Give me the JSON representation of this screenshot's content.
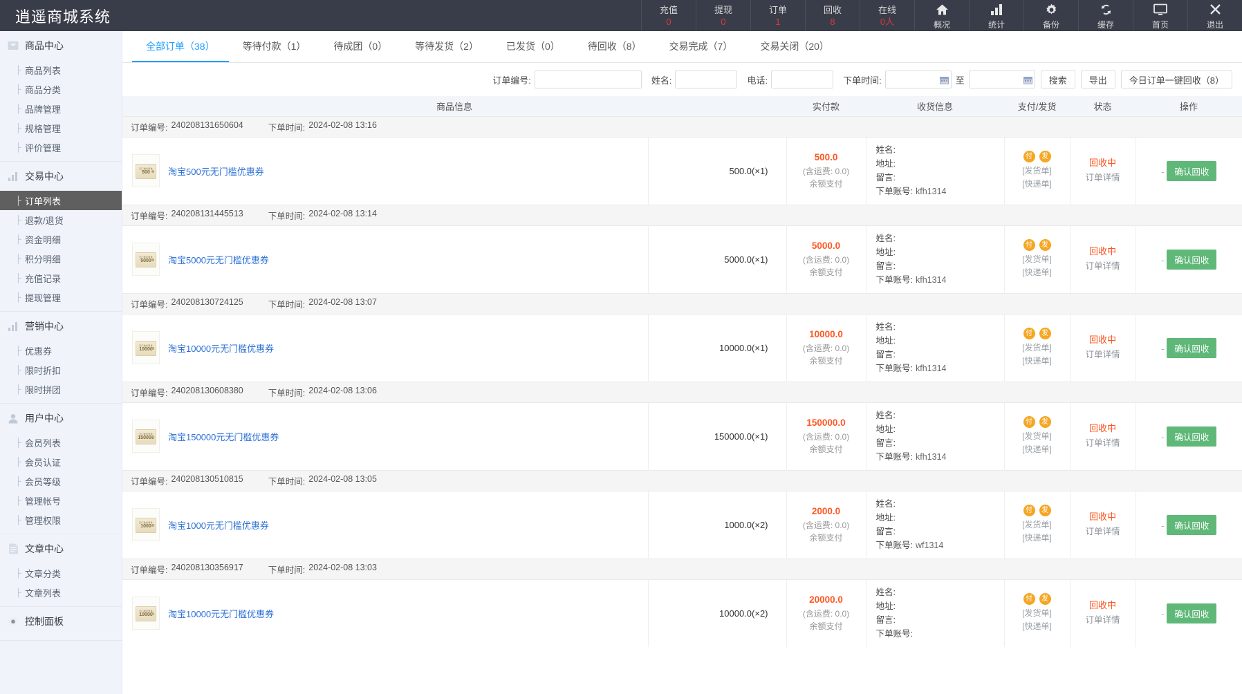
{
  "app": {
    "title": "逍遥商城系统"
  },
  "topbar": {
    "stats": [
      {
        "label": "充值",
        "value": "0"
      },
      {
        "label": "提现",
        "value": "0"
      },
      {
        "label": "订单",
        "value": "1"
      },
      {
        "label": "回收",
        "value": "8"
      },
      {
        "label": "在线",
        "value": "0人"
      }
    ],
    "nav": [
      {
        "label": "概况",
        "icon": "home-icon"
      },
      {
        "label": "统计",
        "icon": "bar-chart-icon"
      },
      {
        "label": "备份",
        "icon": "gear-icon"
      },
      {
        "label": "缓存",
        "icon": "refresh-icon"
      },
      {
        "label": "首页",
        "icon": "monitor-icon"
      },
      {
        "label": "退出",
        "icon": "close-icon"
      }
    ]
  },
  "sidebar": {
    "groups": [
      {
        "title": "商品中心",
        "icon": "box-icon",
        "items": [
          {
            "label": "商品列表",
            "active": false
          },
          {
            "label": "商品分类",
            "active": false
          },
          {
            "label": "品牌管理",
            "active": false
          },
          {
            "label": "规格管理",
            "active": false
          },
          {
            "label": "评价管理",
            "active": false
          }
        ]
      },
      {
        "title": "交易中心",
        "icon": "chart-icon",
        "items": [
          {
            "label": "订单列表",
            "active": true
          },
          {
            "label": "退款/退货",
            "active": false
          },
          {
            "label": "资金明细",
            "active": false
          },
          {
            "label": "积分明细",
            "active": false
          },
          {
            "label": "充值记录",
            "active": false
          },
          {
            "label": "提现管理",
            "active": false
          }
        ]
      },
      {
        "title": "营销中心",
        "icon": "chart-icon",
        "items": [
          {
            "label": "优惠券",
            "active": false
          },
          {
            "label": "限时折扣",
            "active": false
          },
          {
            "label": "限时拼团",
            "active": false
          }
        ]
      },
      {
        "title": "用户中心",
        "icon": "user-icon",
        "items": [
          {
            "label": "会员列表",
            "active": false
          },
          {
            "label": "会员认证",
            "active": false
          },
          {
            "label": "会员等级",
            "active": false
          },
          {
            "label": "管理帐号",
            "active": false
          },
          {
            "label": "管理权限",
            "active": false
          }
        ]
      },
      {
        "title": "文章中心",
        "icon": "doc-icon",
        "items": [
          {
            "label": "文章分类",
            "active": false
          },
          {
            "label": "文章列表",
            "active": false
          }
        ]
      },
      {
        "title": "控制面板",
        "icon": "gear-icon",
        "items": []
      }
    ]
  },
  "tabs": [
    {
      "label": "全部订单（38）",
      "active": true
    },
    {
      "label": "等待付款（1）",
      "active": false
    },
    {
      "label": "待成团（0）",
      "active": false
    },
    {
      "label": "等待发货（2）",
      "active": false
    },
    {
      "label": "已发货（0）",
      "active": false
    },
    {
      "label": "待回收（8）",
      "active": false
    },
    {
      "label": "交易完成（7）",
      "active": false
    },
    {
      "label": "交易关闭（20）",
      "active": false
    }
  ],
  "filters": {
    "order_no_label": "订单编号:",
    "order_no_value": "",
    "name_label": "姓名:",
    "name_value": "",
    "phone_label": "电话:",
    "phone_value": "",
    "date_label": "下单时间:",
    "date_start": "",
    "date_end": "",
    "date_sep": "至",
    "search_button": "搜索",
    "export_button": "导出",
    "bulk_button": "今日订单一键回收（8）"
  },
  "table": {
    "columns": [
      "商品信息",
      "实付款",
      "收货信息",
      "支付/发货",
      "状态",
      "操作"
    ],
    "labels": {
      "order_no": "订单编号:",
      "order_time": "下单时间:",
      "name": "姓名:",
      "address": "地址:",
      "remark": "留言:",
      "account": "下单账号:",
      "freight_prefix": "(含运费:",
      "freight_suffix": ")",
      "pay_method": "余额支付",
      "ship_note": "[发货单]",
      "express_note": "[快递单]",
      "badge_pay": "付",
      "badge_ship": "发",
      "detail": "订单详情",
      "dash": "-"
    },
    "rows": [
      {
        "order_no": "240208131650604",
        "order_time": "2024-02-08 13:16",
        "product": "淘宝500元无门槛优惠券",
        "thumb_top": "无门槛优惠券",
        "thumb_amount": "500",
        "unit_price": "500.0(×1)",
        "paid": "500.0",
        "freight": "0.0",
        "name": "",
        "address": "",
        "remark": "",
        "account": "kfh1314",
        "status": "回收中",
        "action": "确认回收"
      },
      {
        "order_no": "240208131445513",
        "order_time": "2024-02-08 13:14",
        "product": "淘宝5000元无门槛优惠券",
        "thumb_top": "无门槛优惠券",
        "thumb_amount": "5000",
        "unit_price": "5000.0(×1)",
        "paid": "5000.0",
        "freight": "0.0",
        "name": "",
        "address": "",
        "remark": "",
        "account": "kfh1314",
        "status": "回收中",
        "action": "确认回收"
      },
      {
        "order_no": "240208130724125",
        "order_time": "2024-02-08 13:07",
        "product": "淘宝10000元无门槛优惠券",
        "thumb_top": "无门槛优惠券",
        "thumb_amount": "10000",
        "unit_price": "10000.0(×1)",
        "paid": "10000.0",
        "freight": "0.0",
        "name": "",
        "address": "",
        "remark": "",
        "account": "kfh1314",
        "status": "回收中",
        "action": "确认回收"
      },
      {
        "order_no": "240208130608380",
        "order_time": "2024-02-08 13:06",
        "product": "淘宝150000元无门槛优惠券",
        "thumb_top": "无门槛优惠券",
        "thumb_amount": "150000",
        "unit_price": "150000.0(×1)",
        "paid": "150000.0",
        "freight": "0.0",
        "name": "",
        "address": "",
        "remark": "",
        "account": "kfh1314",
        "status": "回收中",
        "action": "确认回收"
      },
      {
        "order_no": "240208130510815",
        "order_time": "2024-02-08 13:05",
        "product": "淘宝1000元无门槛优惠券",
        "thumb_top": "无门槛优惠券",
        "thumb_amount": "1000",
        "unit_price": "1000.0(×2)",
        "paid": "2000.0",
        "freight": "0.0",
        "name": "",
        "address": "",
        "remark": "",
        "account": "wf1314",
        "status": "回收中",
        "action": "确认回收"
      },
      {
        "order_no": "240208130356917",
        "order_time": "2024-02-08 13:03",
        "product": "淘宝10000元无门槛优惠券",
        "thumb_top": "无门槛优惠券",
        "thumb_amount": "10000",
        "unit_price": "10000.0(×2)",
        "paid": "20000.0",
        "freight": "0.0",
        "name": "",
        "address": "",
        "remark": "",
        "account": "",
        "status": "回收中",
        "action": "确认回收"
      }
    ]
  },
  "colors": {
    "topbar_bg": "#393D49",
    "sidebar_bg": "#F0F4FA",
    "accent_blue": "#1E9FFF",
    "accent_orange": "#FF5722",
    "accent_green": "#5FB878",
    "badge_orange": "#F5A623",
    "link_blue": "#2b6fd6"
  }
}
